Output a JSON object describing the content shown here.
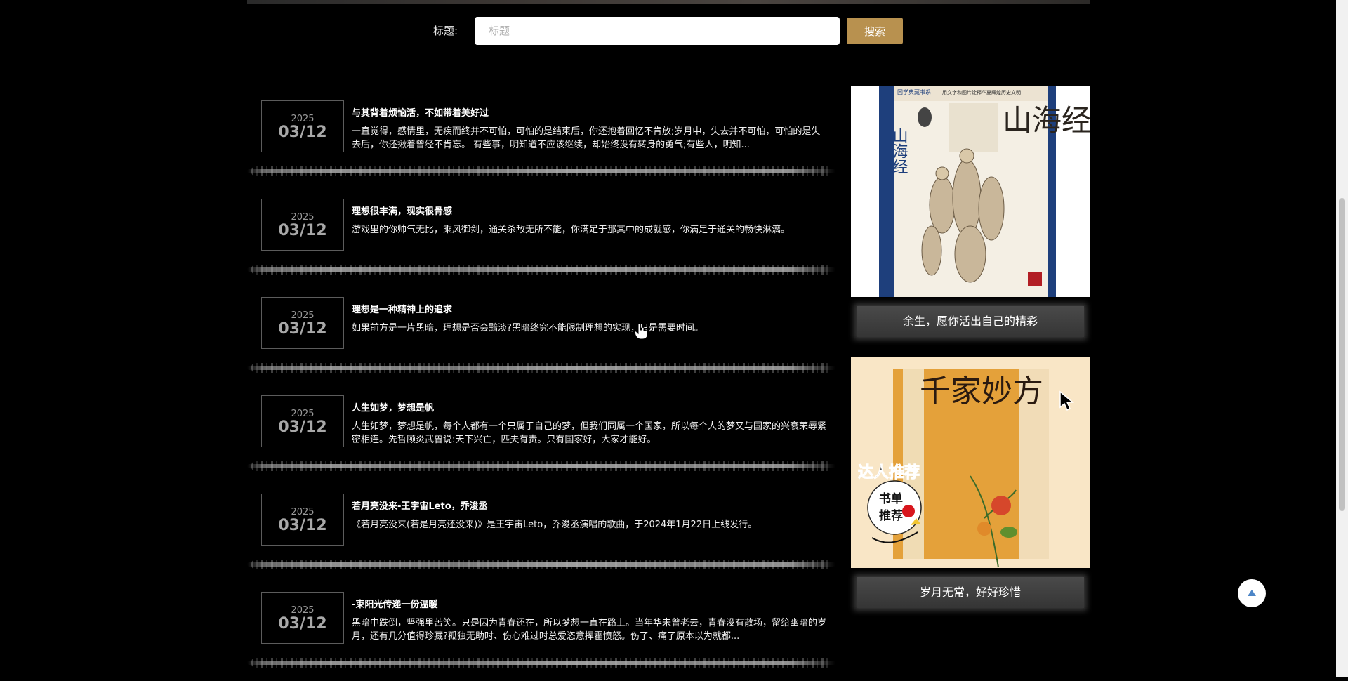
{
  "search": {
    "label": "标题:",
    "placeholder": "标题",
    "button_label": "搜索"
  },
  "articles": [
    {
      "year": "2025",
      "date": "03/12",
      "title": "与其背着烦恼活，不如带着美好过",
      "summary": "一直觉得，感情里，无疾而终并不可怕，可怕的是结束后，你还抱着回忆不肯放;岁月中，失去并不可怕，可怕的是失去后，你还揪着曾经不肯忘。 有些事，明知道不应该继续，却始终没有转身的勇气;有些人，明知..."
    },
    {
      "year": "2025",
      "date": "03/12",
      "title": "理想很丰满，现实很骨感",
      "summary": "游戏里的你帅气无比，乘风御剑，通关杀敌无所不能，你满足于那其中的成就感，你满足于通关的畅快淋漓。"
    },
    {
      "year": "2025",
      "date": "03/12",
      "title": "理想是一种精神上的追求",
      "summary": "如果前方是一片黑暗，理想是否会黯淡?黑暗终究不能限制理想的实现，只是需要时间。"
    },
    {
      "year": "2025",
      "date": "03/12",
      "title": "人生如梦，梦想是帆",
      "summary": "人生如梦，梦想是帆，每个人都有一个只属于自己的梦，但我们同属一个国家，所以每个人的梦又与国家的兴衰荣辱紧密相连。先哲顾炎武曾说:天下兴亡，匹夫有责。只有国家好，大家才能好。"
    },
    {
      "year": "2025",
      "date": "03/12",
      "title": "若月亮没来-王宇宙Leto，乔浚丞",
      "summary": "《若月亮没来(若是月亮还没来)》是王宇宙Leto，乔浚丞演唱的歌曲，于2024年1月22日上线发行。"
    },
    {
      "year": "2025",
      "date": "03/12",
      "title": "-束阳光传递一份温暖",
      "summary": "黑暗中跌倒，坚强里苦笑。只是因为青春还在，所以梦想一直在路上。当年华未曾老去，青春没有散场，留给幽暗的岁月，还有几分值得珍藏?孤独无助时、伤心难过时总爱恣意挥霍愤怒。伤了、痛了原本以为就都..."
    }
  ],
  "sidebar": {
    "books": [
      {
        "caption": "余生，愿你活出自己的精彩",
        "cover_title": "山海经",
        "cover_series": "国学典藏书系",
        "cover_tagline": "用文字和图片诠释华夏辉煌历史文明"
      },
      {
        "caption": "岁月无常，好好珍惜",
        "cover_title": "千家妙方",
        "cover_badge_1": "达人推荐",
        "cover_badge_2": "书单",
        "cover_badge_3": "推荐"
      }
    ]
  },
  "colors": {
    "background": "#000000",
    "accent_button": "#b8914f",
    "caption_bg": "#3f3f3f",
    "date_border": "#5c5c5c"
  },
  "icons": {
    "back_to_top": "caret-up-icon",
    "cursor": "arrow-cursor-icon"
  }
}
